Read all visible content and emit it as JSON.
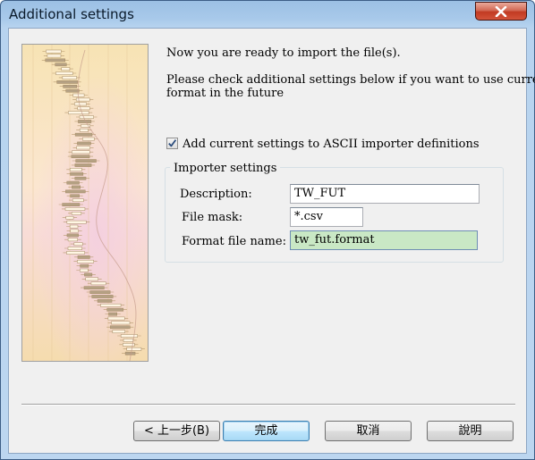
{
  "window": {
    "title": "Additional settings"
  },
  "intro": {
    "line1": "Now you are ready to import the file(s).",
    "line2a": "Please check additional settings below if you want to use current",
    "line2b": "format in the future"
  },
  "checkbox": {
    "label": "Add current settings to ASCII importer definitions",
    "checked": true
  },
  "importer_settings": {
    "title": "Importer settings",
    "description_label": "Description:",
    "description_value": "TW_FUT",
    "file_mask_label": "File mask:",
    "file_mask_value": "*.csv",
    "format_file_label": "Format file name:",
    "format_file_value": "tw_fut.format"
  },
  "buttons": {
    "back": "< 上一步(B)",
    "finish": "完成",
    "cancel": "取消",
    "help": "說明"
  },
  "colors": {
    "title_bar": "#a8c9ea",
    "close_button": "#c23a22",
    "highlight_field": "#c9e8c5",
    "default_button": "#bee6fd"
  }
}
